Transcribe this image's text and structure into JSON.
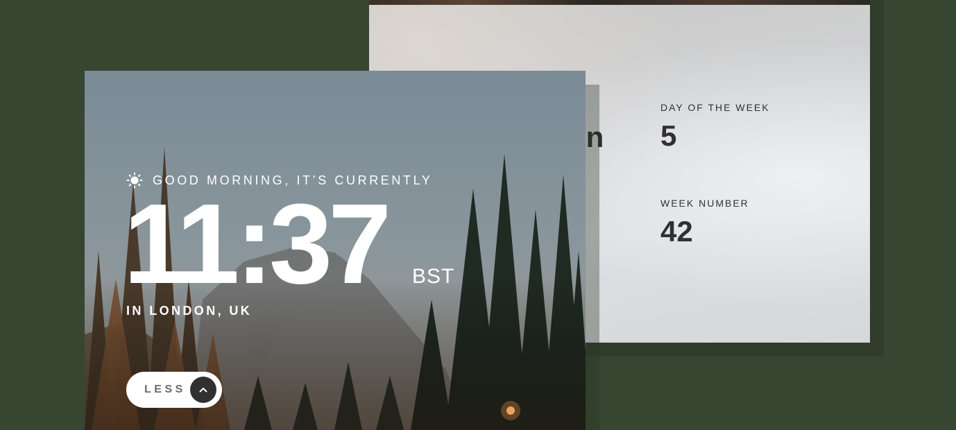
{
  "greeting": {
    "icon": "sun-icon",
    "text": "GOOD MORNING, IT’S CURRENTLY"
  },
  "clock": {
    "time": "11:37",
    "timezone": "BST",
    "location": "IN LONDON, UK"
  },
  "toggle": {
    "label": "LESS",
    "icon": "chevron-up-icon"
  },
  "details": {
    "partial_text": "on",
    "day_of_week_label": "DAY OF THE WEEK",
    "day_of_week_value": "5",
    "week_number_label": "WEEK NUMBER",
    "week_number_value": "42"
  },
  "colors": {
    "page_background": "#374630",
    "panel_text": "#303030",
    "button_background": "#ffffff",
    "button_icon_background": "#303030"
  }
}
